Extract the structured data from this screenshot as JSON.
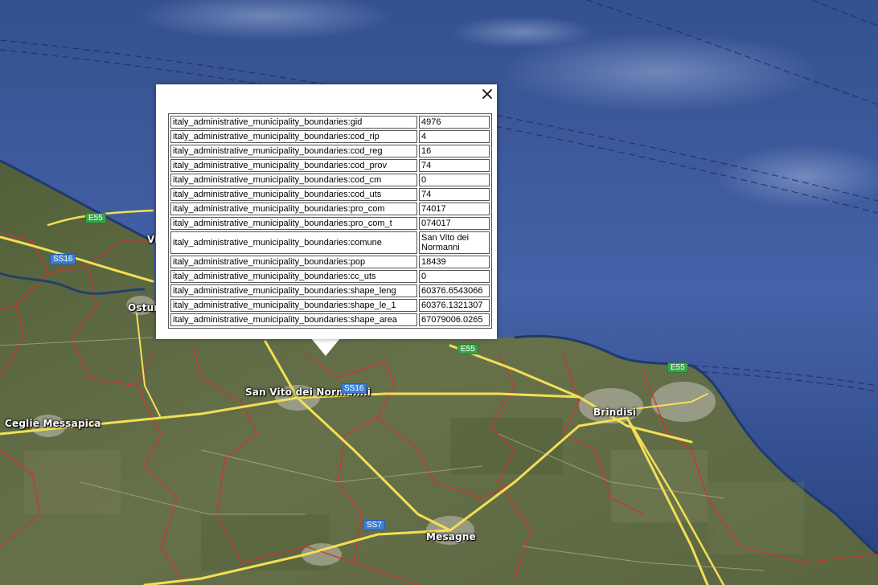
{
  "map": {
    "places": [
      {
        "id": "ostuni",
        "label": "Ostuni"
      },
      {
        "id": "san-vito",
        "label": "San Vito dei Normanni"
      },
      {
        "id": "ceglie",
        "label": "Ceglie Messapica"
      },
      {
        "id": "brindisi",
        "label": "Brindisi"
      },
      {
        "id": "mesagne",
        "label": "Mesagne"
      },
      {
        "id": "vi-partial",
        "label": "Vi"
      }
    ],
    "road_shields": [
      {
        "id": "e55-a",
        "label": "E55",
        "kind": "e"
      },
      {
        "id": "ss16-a",
        "label": "SS16",
        "kind": "ss"
      },
      {
        "id": "ss16-b",
        "label": "SS16",
        "kind": "ss"
      },
      {
        "id": "e55-b",
        "label": "E55",
        "kind": "e"
      },
      {
        "id": "e55-c",
        "label": "E55",
        "kind": "e"
      },
      {
        "id": "ss7",
        "label": "SS7",
        "kind": "ss"
      }
    ],
    "colors": {
      "sea": "#3f5aa0",
      "land": "#5c6a40",
      "boundary": "#d0342c",
      "road": "#f3df55"
    }
  },
  "popup": {
    "close_icon": "close-icon",
    "rows": [
      {
        "key": "italy_administrative_municipality_boundaries:gid",
        "value": "4976"
      },
      {
        "key": "italy_administrative_municipality_boundaries:cod_rip",
        "value": "4"
      },
      {
        "key": "italy_administrative_municipality_boundaries:cod_reg",
        "value": "16"
      },
      {
        "key": "italy_administrative_municipality_boundaries:cod_prov",
        "value": "74"
      },
      {
        "key": "italy_administrative_municipality_boundaries:cod_cm",
        "value": "0"
      },
      {
        "key": "italy_administrative_municipality_boundaries:cod_uts",
        "value": "74"
      },
      {
        "key": "italy_administrative_municipality_boundaries:pro_com",
        "value": "74017"
      },
      {
        "key": "italy_administrative_municipality_boundaries:pro_com_t",
        "value": "074017"
      },
      {
        "key": "italy_administrative_municipality_boundaries:comune",
        "value": "San Vito dei Normanni"
      },
      {
        "key": "italy_administrative_municipality_boundaries:pop",
        "value": "18439"
      },
      {
        "key": "italy_administrative_municipality_boundaries:cc_uts",
        "value": "0"
      },
      {
        "key": "italy_administrative_municipality_boundaries:shape_leng",
        "value": "60376.6543066"
      },
      {
        "key": "italy_administrative_municipality_boundaries:shape_le_1",
        "value": "60376.1321307"
      },
      {
        "key": "italy_administrative_municipality_boundaries:shape_area",
        "value": "67079006.0265"
      }
    ]
  }
}
